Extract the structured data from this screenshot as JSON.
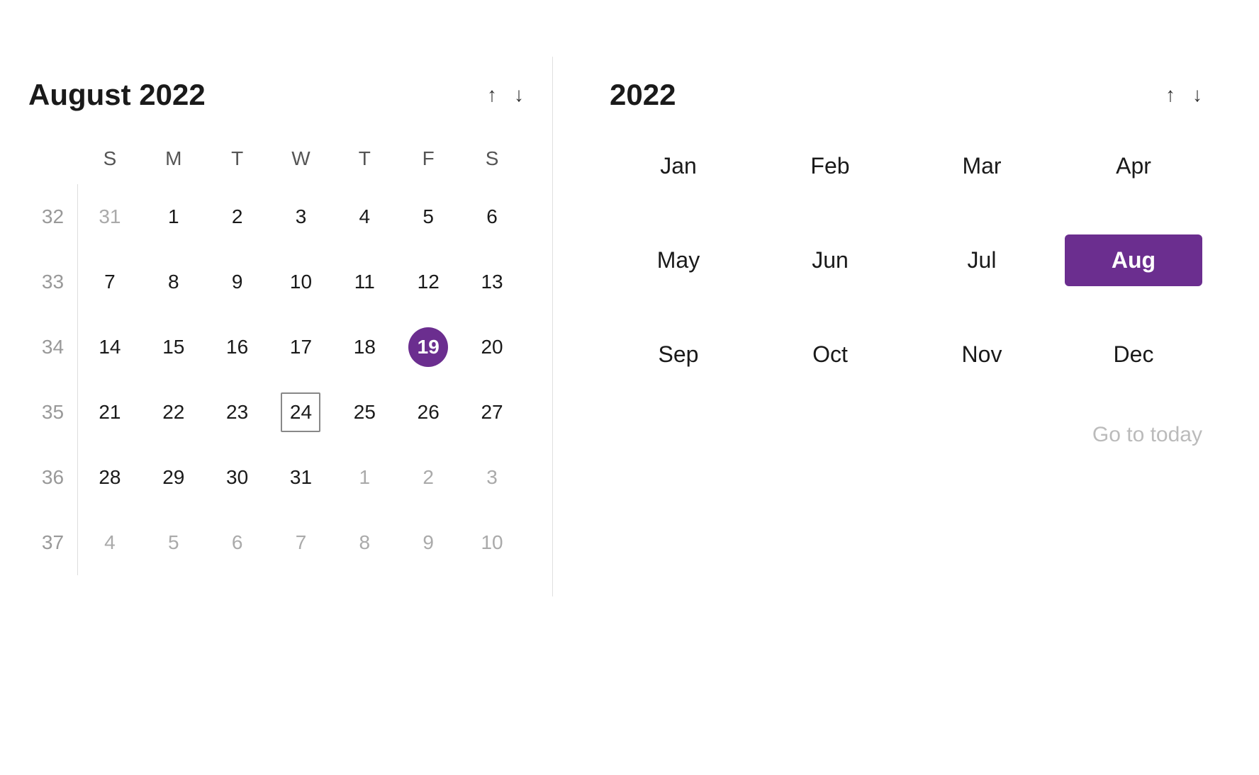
{
  "left": {
    "title": "August 2022",
    "nav_up_label": "↑",
    "nav_down_label": "↓",
    "days_of_week": [
      "S",
      "M",
      "T",
      "W",
      "T",
      "F",
      "S"
    ],
    "weeks": [
      {
        "week_num": "32",
        "days": [
          {
            "num": "31",
            "other": true,
            "selected": false,
            "today": false
          },
          {
            "num": "1",
            "other": false,
            "selected": false,
            "today": false
          },
          {
            "num": "2",
            "other": false,
            "selected": false,
            "today": false
          },
          {
            "num": "3",
            "other": false,
            "selected": false,
            "today": false
          },
          {
            "num": "4",
            "other": false,
            "selected": false,
            "today": false
          },
          {
            "num": "5",
            "other": false,
            "selected": false,
            "today": false
          },
          {
            "num": "6",
            "other": false,
            "selected": false,
            "today": false
          }
        ]
      },
      {
        "week_num": "33",
        "days": [
          {
            "num": "7",
            "other": false,
            "selected": false,
            "today": false
          },
          {
            "num": "8",
            "other": false,
            "selected": false,
            "today": false
          },
          {
            "num": "9",
            "other": false,
            "selected": false,
            "today": false
          },
          {
            "num": "10",
            "other": false,
            "selected": false,
            "today": false
          },
          {
            "num": "11",
            "other": false,
            "selected": false,
            "today": false
          },
          {
            "num": "12",
            "other": false,
            "selected": false,
            "today": false
          },
          {
            "num": "13",
            "other": false,
            "selected": false,
            "today": false
          }
        ]
      },
      {
        "week_num": "34",
        "days": [
          {
            "num": "14",
            "other": false,
            "selected": false,
            "today": false
          },
          {
            "num": "15",
            "other": false,
            "selected": false,
            "today": false
          },
          {
            "num": "16",
            "other": false,
            "selected": false,
            "today": false
          },
          {
            "num": "17",
            "other": false,
            "selected": false,
            "today": false
          },
          {
            "num": "18",
            "other": false,
            "selected": false,
            "today": false
          },
          {
            "num": "19",
            "other": false,
            "selected": true,
            "today": false
          },
          {
            "num": "20",
            "other": false,
            "selected": false,
            "today": false
          }
        ]
      },
      {
        "week_num": "35",
        "days": [
          {
            "num": "21",
            "other": false,
            "selected": false,
            "today": false
          },
          {
            "num": "22",
            "other": false,
            "selected": false,
            "today": false
          },
          {
            "num": "23",
            "other": false,
            "selected": false,
            "today": false
          },
          {
            "num": "24",
            "other": false,
            "selected": false,
            "today": true
          },
          {
            "num": "25",
            "other": false,
            "selected": false,
            "today": false
          },
          {
            "num": "26",
            "other": false,
            "selected": false,
            "today": false
          },
          {
            "num": "27",
            "other": false,
            "selected": false,
            "today": false
          }
        ]
      },
      {
        "week_num": "36",
        "days": [
          {
            "num": "28",
            "other": false,
            "selected": false,
            "today": false
          },
          {
            "num": "29",
            "other": false,
            "selected": false,
            "today": false
          },
          {
            "num": "30",
            "other": false,
            "selected": false,
            "today": false
          },
          {
            "num": "31",
            "other": false,
            "selected": false,
            "today": false
          },
          {
            "num": "1",
            "other": true,
            "selected": false,
            "today": false
          },
          {
            "num": "2",
            "other": true,
            "selected": false,
            "today": false
          },
          {
            "num": "3",
            "other": true,
            "selected": false,
            "today": false
          }
        ]
      },
      {
        "week_num": "37",
        "days": [
          {
            "num": "4",
            "other": true,
            "selected": false,
            "today": false
          },
          {
            "num": "5",
            "other": true,
            "selected": false,
            "today": false
          },
          {
            "num": "6",
            "other": true,
            "selected": false,
            "today": false
          },
          {
            "num": "7",
            "other": true,
            "selected": false,
            "today": false
          },
          {
            "num": "8",
            "other": true,
            "selected": false,
            "today": false
          },
          {
            "num": "9",
            "other": true,
            "selected": false,
            "today": false
          },
          {
            "num": "10",
            "other": true,
            "selected": false,
            "today": false
          }
        ]
      }
    ]
  },
  "right": {
    "year_title": "2022",
    "nav_up_label": "↑",
    "nav_down_label": "↓",
    "months": [
      {
        "label": "Jan",
        "selected": false
      },
      {
        "label": "Feb",
        "selected": false
      },
      {
        "label": "Mar",
        "selected": false
      },
      {
        "label": "Apr",
        "selected": false
      },
      {
        "label": "May",
        "selected": false
      },
      {
        "label": "Jun",
        "selected": false
      },
      {
        "label": "Jul",
        "selected": false
      },
      {
        "label": "Aug",
        "selected": true
      },
      {
        "label": "Sep",
        "selected": false
      },
      {
        "label": "Oct",
        "selected": false
      },
      {
        "label": "Nov",
        "selected": false
      },
      {
        "label": "Dec",
        "selected": false
      }
    ],
    "go_to_today": "Go to today"
  }
}
